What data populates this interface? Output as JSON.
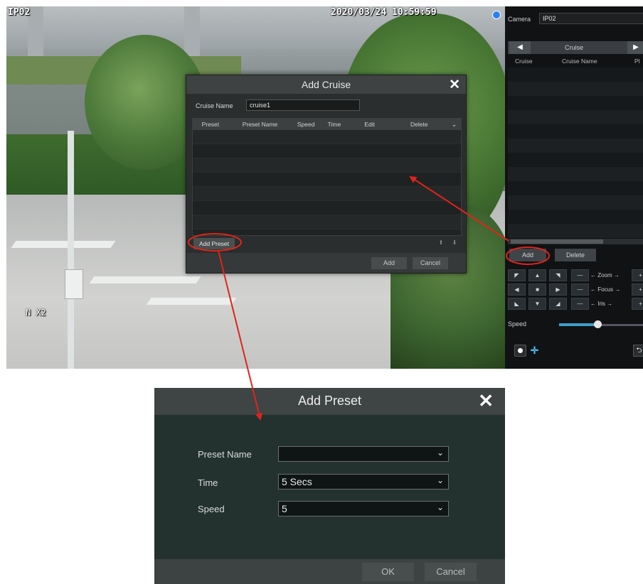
{
  "camera_view": {
    "channel_label": "IP02",
    "timestamp": "2020/03/24 10:59:59",
    "zoom_label": "N X2"
  },
  "add_cruise_dialog": {
    "title": "Add Cruise",
    "close_icon": "close-icon",
    "cruise_name_label": "Cruise Name",
    "cruise_name_value": "cruise1",
    "columns": [
      "Preset",
      "Preset Name",
      "Speed",
      "Time",
      "Edit",
      "Delete"
    ],
    "rows": [],
    "add_preset_button": "Add Preset",
    "add_button": "Add",
    "cancel_button": "Cancel"
  },
  "ptz_panel": {
    "camera_label": "Camera",
    "camera_value": "IP02",
    "tab_label": "Cruise",
    "columns": [
      "Cruise",
      "Cruise Name",
      "Pl"
    ],
    "add_button": "Add",
    "delete_button": "Delete",
    "zoom_label": "← Zoom →",
    "focus_label": "← Focus →",
    "iris_label": "←  Iris  →",
    "speed_label": "Speed",
    "speed_level": 0.45
  },
  "add_preset_dialog": {
    "title": "Add Preset",
    "close_icon": "close-icon",
    "preset_name_label": "Preset Name",
    "preset_name_value": "",
    "time_label": "Time",
    "time_value": "5 Secs",
    "speed_label": "Speed",
    "speed_value": "5",
    "ok_button": "OK",
    "cancel_button": "Cancel"
  },
  "colors": {
    "highlight": "#e0241b",
    "accent": "#3ea0c8"
  }
}
